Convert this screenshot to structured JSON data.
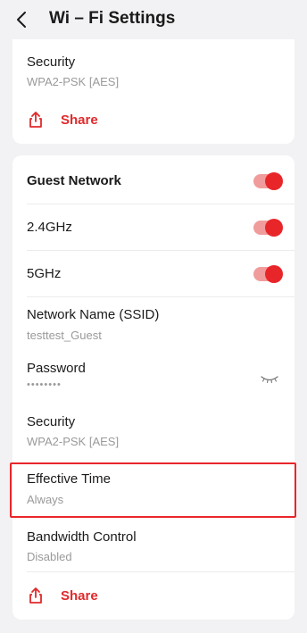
{
  "header": {
    "title": "Wi – Fi Settings"
  },
  "main_network": {
    "security_label": "Security",
    "security_value": "WPA2-PSK [AES]",
    "share_label": "Share"
  },
  "guest_network": {
    "guest_label": "Guest Network",
    "guest_enabled": true,
    "band_24_label": "2.4GHz",
    "band_24_enabled": true,
    "band_5_label": "5GHz",
    "band_5_enabled": true,
    "ssid_label": "Network Name (SSID)",
    "ssid_value": "testtest_Guest",
    "password_label": "Password",
    "password_value": "••••••••",
    "security_label": "Security",
    "security_value": "WPA2-PSK [AES]",
    "effective_time_label": "Effective Time",
    "effective_time_value": "Always",
    "bandwidth_label": "Bandwidth Control",
    "bandwidth_value": "Disabled",
    "share_label": "Share"
  },
  "icons": {
    "back": "chevron-left-icon",
    "share": "share-icon",
    "password_visibility": "eye-closed-icon"
  },
  "colors": {
    "accent": "#e8262a",
    "toggle_track": "#f19c9c",
    "background": "#f2f2f5",
    "secondary_text": "#9a9a9a"
  }
}
